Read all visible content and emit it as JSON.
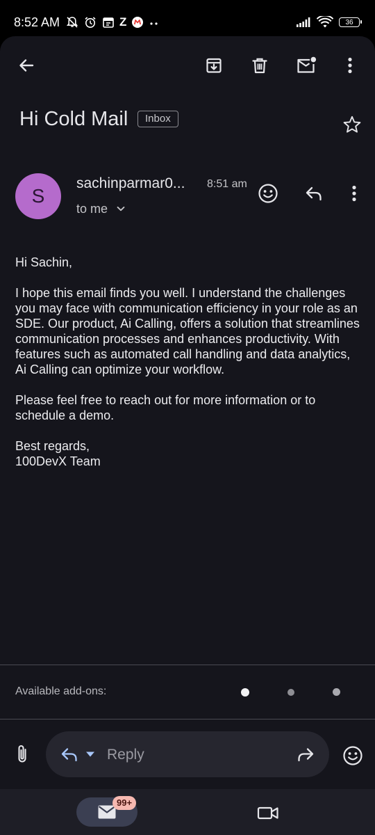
{
  "status_bar": {
    "time": "8:52 AM",
    "notification_letter": "Z",
    "battery": "36"
  },
  "toolbar": {
    "back_icon": "arrow-back-icon",
    "archive_icon": "archive-icon",
    "delete_icon": "trash-icon",
    "mark_unread_icon": "mail-unread-icon",
    "more_icon": "more-vert-icon"
  },
  "email": {
    "subject": "Hi Cold Mail",
    "label": "Inbox",
    "starred": false,
    "sender_initial": "S",
    "sender_name": "sachinparmar0...",
    "time": "8:51 am",
    "recipient": "to me",
    "body": {
      "greeting": "Hi Sachin,",
      "paragraph1": "I hope this email finds you well. I understand the challenges you may face with communication efficiency in your role as an SDE. Our product, Ai Calling, offers a solution that streamlines communication processes and enhances productivity. With features such as automated call handling and data analytics, Ai Calling can optimize your workflow.",
      "paragraph2": "Please feel free to reach out for more information or to schedule a demo.",
      "signoff": "Best regards,",
      "signature": "100DevX Team"
    }
  },
  "addons": {
    "label": "Available add-ons:"
  },
  "composer": {
    "reply_placeholder": "Reply"
  },
  "bottom_nav": {
    "mail_badge": "99+"
  },
  "colors": {
    "surface": "#15151c",
    "avatar": "#b56bcc",
    "badge": "#f6b8b0",
    "reply_bar": "#26262f",
    "nav_active": "#3b3f52"
  }
}
